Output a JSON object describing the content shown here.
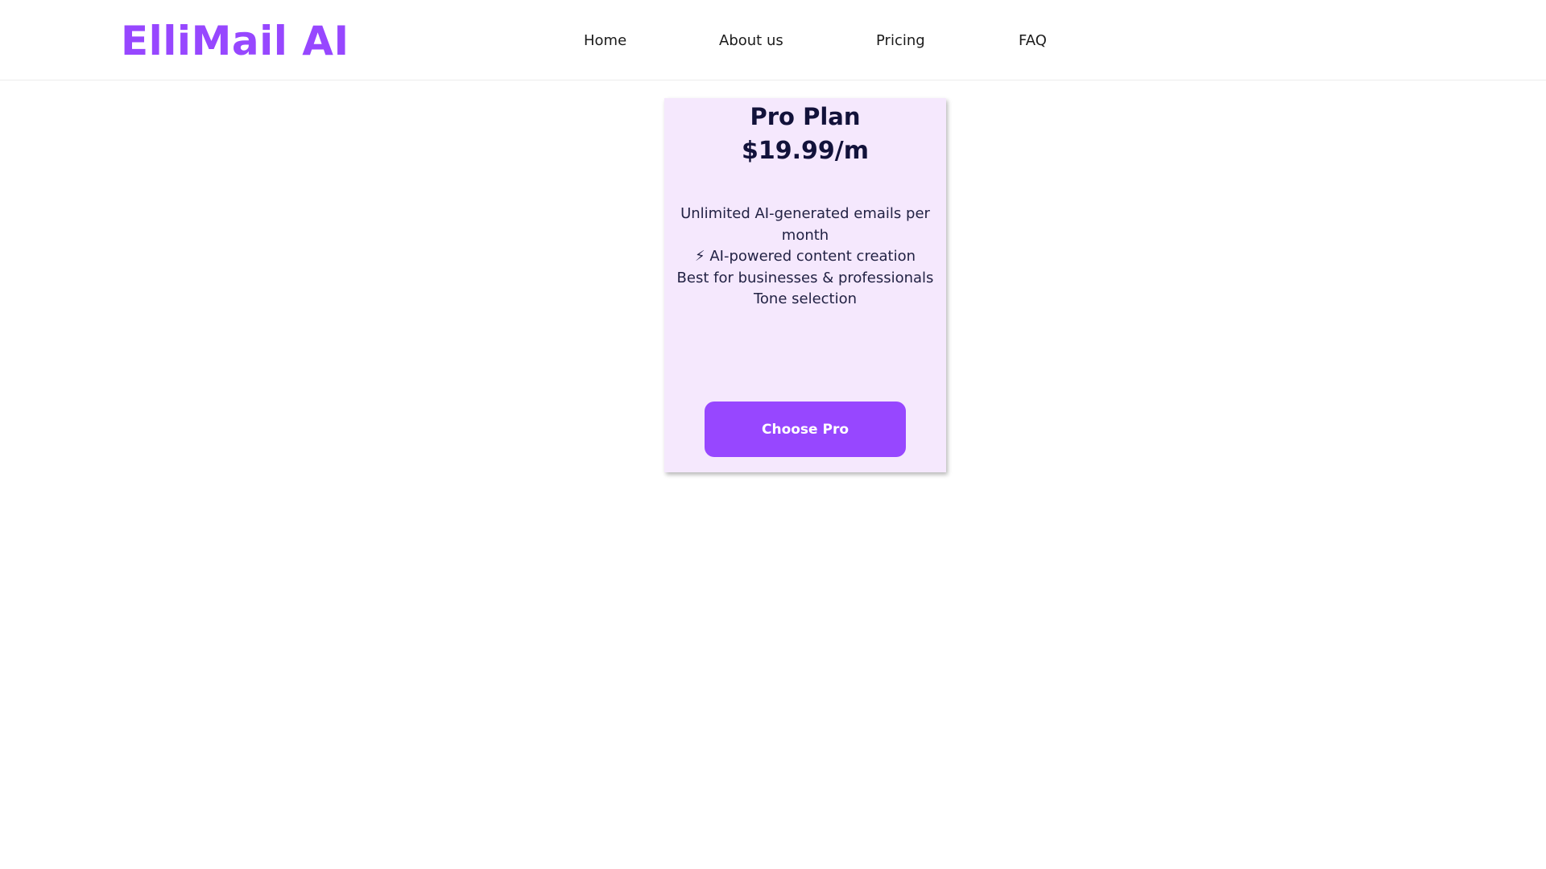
{
  "brand": {
    "name": "ElliMail AI",
    "accent_color": "#9747ff"
  },
  "nav": {
    "items": [
      {
        "label": "Home"
      },
      {
        "label": "About us"
      },
      {
        "label": "Pricing"
      },
      {
        "label": "FAQ"
      }
    ]
  },
  "plan": {
    "name": "Pro Plan",
    "price": "$19.99/m",
    "features": [
      {
        "icon": "unknown-glyph",
        "text": " Unlimited AI-generated emails per month"
      },
      {
        "icon": "lightning-icon",
        "text": "⚡ AI-powered content creation"
      },
      {
        "icon": "unknown-glyph",
        "text": " Best for businesses & professionals"
      },
      {
        "icon": "unknown-glyph",
        "text": " Tone selection"
      }
    ],
    "cta_label": "Choose Pro",
    "card_color": "#f5e8fd"
  }
}
